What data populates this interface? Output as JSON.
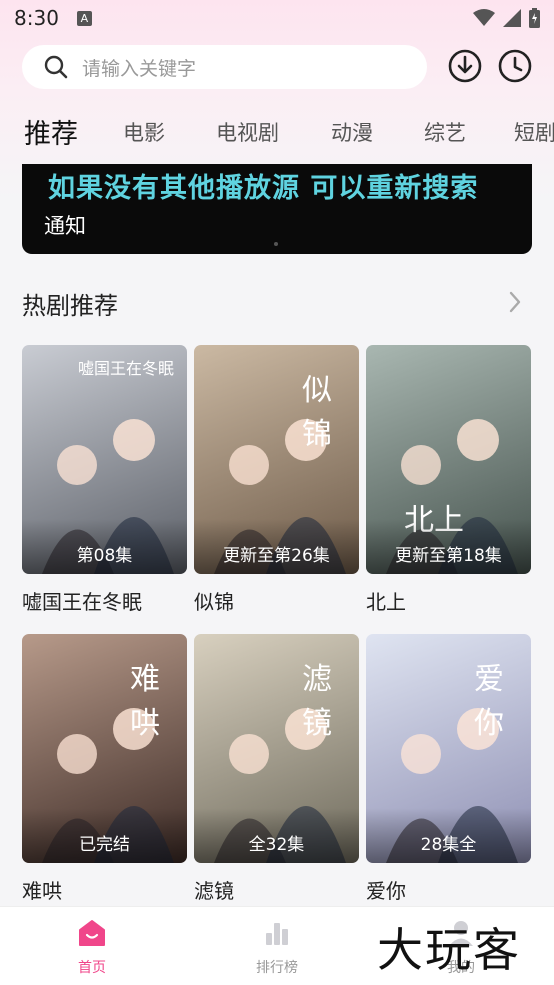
{
  "status_bar": {
    "time": "8:30",
    "notif_letter": "A"
  },
  "search": {
    "placeholder": "请输入关键字"
  },
  "tabs": [
    "推荐",
    "电影",
    "电视剧",
    "动漫",
    "综艺",
    "短剧"
  ],
  "active_tab": "推荐",
  "banner": {
    "title": "如果没有其他播放源 可以重新搜索",
    "subtitle": "通知"
  },
  "section": {
    "title": "热剧推荐"
  },
  "dramas": [
    {
      "title": "嘘国王在冬眠",
      "badge": "第08集",
      "art_text": "嘘国王在冬眠",
      "colors": [
        "#c9ccd3",
        "#5a5e66"
      ]
    },
    {
      "title": "似锦",
      "badge": "更新至第26集",
      "art_text": "似锦",
      "colors": [
        "#cbb9a3",
        "#6d5a48"
      ]
    },
    {
      "title": "北上",
      "badge": "更新至第18集",
      "art_text": "北上",
      "colors": [
        "#a9b7b1",
        "#45524d"
      ]
    },
    {
      "title": "难哄",
      "badge": "已完结",
      "art_text": "难哄",
      "colors": [
        "#b79a8a",
        "#3d2b26"
      ]
    },
    {
      "title": "滤镜",
      "badge": "全32集",
      "art_text": "滤镜",
      "colors": [
        "#d8d0bf",
        "#6e6a5c"
      ]
    },
    {
      "title": "爱你",
      "badge": "28集全",
      "art_text": "爱你",
      "colors": [
        "#dfe4f1",
        "#8e8fb3"
      ]
    }
  ],
  "bottom_nav": [
    {
      "label": "首页",
      "icon": "home-icon",
      "active": true
    },
    {
      "label": "排行榜",
      "icon": "rank-icon",
      "active": false
    },
    {
      "label": "我的",
      "icon": "profile-icon",
      "active": false
    }
  ],
  "watermark": "大玩客",
  "colors": {
    "accent": "#f0468a",
    "banner_text": "#5fd3e0"
  }
}
